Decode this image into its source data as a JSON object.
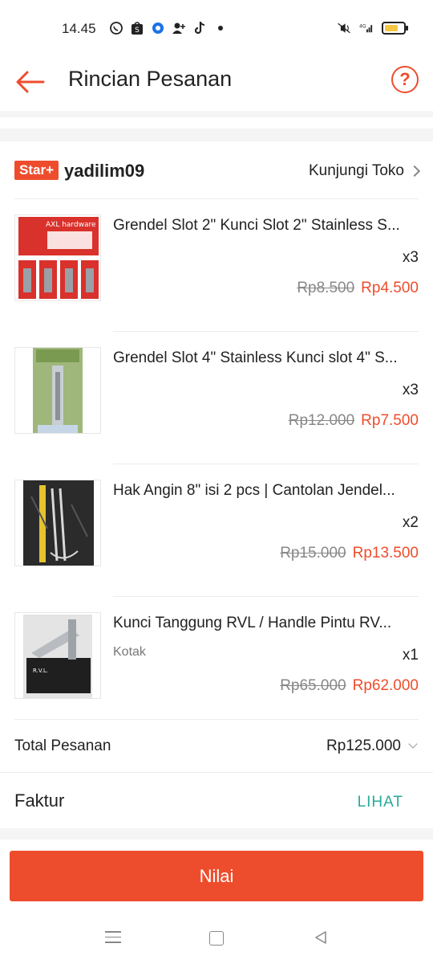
{
  "status_bar": {
    "time": "14.45",
    "network": "4G"
  },
  "header": {
    "title": "Rincian Pesanan"
  },
  "shop": {
    "badge": "Star+",
    "name": "yadilim09",
    "visit_label": "Kunjungi Toko"
  },
  "products": [
    {
      "name": "Grendel Slot 2\" Kunci Slot 2\" Stainless S...",
      "variant": "",
      "qty": "x3",
      "original_price": "Rp8.500",
      "price": "Rp4.500"
    },
    {
      "name": "Grendel Slot 4\" Stainless Kunci slot 4\" S...",
      "variant": "",
      "qty": "x3",
      "original_price": "Rp12.000",
      "price": "Rp7.500"
    },
    {
      "name": "Hak Angin 8\" isi 2 pcs | Cantolan Jendel...",
      "variant": "",
      "qty": "x2",
      "original_price": "Rp15.000",
      "price": "Rp13.500"
    },
    {
      "name": "Kunci Tanggung RVL / Handle Pintu RV...",
      "variant": "Kotak",
      "qty": "x1",
      "original_price": "Rp65.000",
      "price": "Rp62.000"
    }
  ],
  "product_images": {
    "p1_brand": "AXL hardware",
    "p4_brand": "R.V.L."
  },
  "total": {
    "label": "Total Pesanan",
    "value": "Rp125.000"
  },
  "invoice": {
    "label": "Faktur",
    "link": "LIHAT"
  },
  "actions": {
    "rate_label": "Nilai"
  },
  "colors": {
    "accent": "#ee4d2d",
    "link": "#26aa99"
  }
}
